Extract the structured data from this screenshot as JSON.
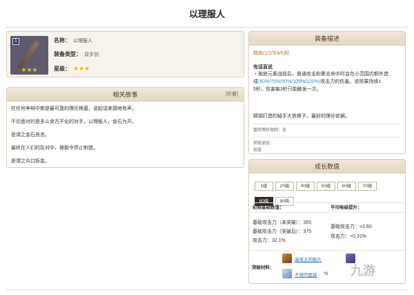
{
  "page": {
    "title": "以理服人"
  },
  "card": {
    "badge": "1",
    "stars": "★★★",
    "name_label": "名称：",
    "name_value": "以理服人",
    "type_label": "装备类型：",
    "type_value": "双手剑",
    "rarity_label": "星级：",
    "rarity_stars": "★★★"
  },
  "story": {
    "title": "相关故事",
    "edit_label": "[折叠]",
    "lines": [
      "在任何争辩中都是最可靠的理论根基，说起话来掷地有声。",
      "不论面对的是多么食古不化的对手，以理服人，金石为开。",
      "是谓之金石良言。",
      "最终在人们的反对中，被勒令停止制造。",
      "是谓之众口铄金。"
    ]
  },
  "equip": {
    "title": "装备描述",
    "refine": "精炼(1/2/3/4/5)阶",
    "passive_name": "有话直说",
    "passive_1": "・施放元素战技后，普通攻击和重击命中时会在小范围内额外造",
    "passive_2a": "成",
    "passive_2b": "(60%/75%/90%/105%/120%)",
    "passive_2c": "攻击力的伤害。该效果持续1",
    "passive_3": "5秒，伤害每3秒只能触发一次。",
    "quote": "精钢打造的疑手大铁棒子。最好的理论依据。",
    "limit": "冒险等阶限制：无",
    "source_label": "获取途径：",
    "source_value": "祈愿"
  },
  "growth": {
    "title": "成长数值",
    "levels": [
      "1级",
      "20级",
      "40级",
      "50级",
      "60级",
      "70级",
      "80级",
      "90级"
    ],
    "active_level": "80级",
    "base_header": "初始基础数值：",
    "avg_header": "平均每级提升：",
    "base_atk_1": "基础攻击力（未突破）：355",
    "base_atk_2": "基础攻击力（突破后）：375",
    "atk_pct": "攻击力：32.1%",
    "avg_atk": "基础攻击力：+2.60",
    "avg_pct": "攻击力：+0.31%",
    "mat_label": "突破材料：",
    "mat_1": "高塔王的断片",
    "mat_2": "不祥的面具",
    "mat_2_count": "*8"
  },
  "watermark": "九游"
}
